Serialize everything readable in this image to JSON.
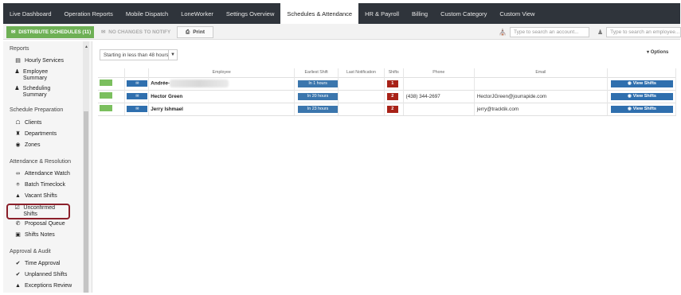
{
  "nav": {
    "tabs": [
      {
        "label": "Live Dashboard"
      },
      {
        "label": "Operation Reports"
      },
      {
        "label": "Mobile Dispatch"
      },
      {
        "label": "LoneWorker"
      },
      {
        "label": "Settings Overview"
      },
      {
        "label": "Schedules & Attendance",
        "active": true
      },
      {
        "label": "HR & Payroll"
      },
      {
        "label": "Billing"
      },
      {
        "label": "Custom Category"
      },
      {
        "label": "Custom View"
      }
    ]
  },
  "toolbar": {
    "distribute_label": "DISTRIBUTE SCHEDULES (11)",
    "no_changes_label": "NO CHANGES TO NOTIFY",
    "print_label": "Print",
    "search_account_placeholder": "Type to search an account...",
    "search_employee_placeholder": "Type to search an employee..."
  },
  "sidebar": {
    "sections": [
      {
        "title": "Reports",
        "items": [
          {
            "label": "Hourly Services",
            "icon": "document-icon"
          },
          {
            "label": "Employee Summary",
            "icon": "person-icon"
          },
          {
            "label": "Scheduling Summary",
            "icon": "person-icon"
          }
        ]
      },
      {
        "title": "Schedule Preparation",
        "items": [
          {
            "label": "Clients",
            "icon": "home-icon"
          },
          {
            "label": "Departments",
            "icon": "building-icon"
          },
          {
            "label": "Zones",
            "icon": "binoculars-icon"
          }
        ]
      },
      {
        "title": "Attendance & Resolution",
        "items": [
          {
            "label": "Attendance Watch",
            "icon": "glasses-icon"
          },
          {
            "label": "Batch Timeclock",
            "icon": "timeclock-icon"
          },
          {
            "label": "Vacant Shifts",
            "icon": "warning-icon"
          },
          {
            "label": "Unconfirmed Shifts",
            "icon": "checkbox-icon",
            "highlighted": true
          },
          {
            "label": "Proposal Queue",
            "icon": "phone-icon"
          },
          {
            "label": "Shifts Notes",
            "icon": "inbox-icon"
          }
        ]
      },
      {
        "title": "Approval & Audit",
        "items": [
          {
            "label": "Time Approval",
            "icon": "check-icon"
          },
          {
            "label": "Unplanned Shifts",
            "icon": "check-icon"
          },
          {
            "label": "Exceptions Review",
            "icon": "warning-icon"
          }
        ]
      }
    ]
  },
  "main": {
    "filter_value": "Starting in less than 48 hours",
    "options_label": "Options",
    "columns": [
      "Employee",
      "Earliest Shift",
      "Last Notification",
      "Shifts",
      "Phone",
      "Email"
    ],
    "rows": [
      {
        "employee": "Andrée-",
        "earliest": "In 1 hours",
        "last_notification": "",
        "shifts": "1",
        "phone": "",
        "email": "",
        "action": "View Shifts",
        "redacted": true
      },
      {
        "employee": "Hector Green",
        "earliest": "In 20 hours",
        "last_notification": "",
        "shifts": "2",
        "phone": "(438) 344-2697",
        "email": "HectorJGreen@jourrapide.com",
        "action": "View Shifts"
      },
      {
        "employee": "Jerry Ishmael",
        "earliest": "In 23 hours",
        "last_notification": "",
        "shifts": "2",
        "phone": "",
        "email": "jerry@tracktik.com",
        "action": "View Shifts"
      }
    ]
  },
  "colors": {
    "nav_bg": "#2f343b",
    "distribute_green": "#6eb055",
    "action_blue": "#2f6fae",
    "shifts_red": "#a82218",
    "highlight_red": "#8b1f2a"
  }
}
